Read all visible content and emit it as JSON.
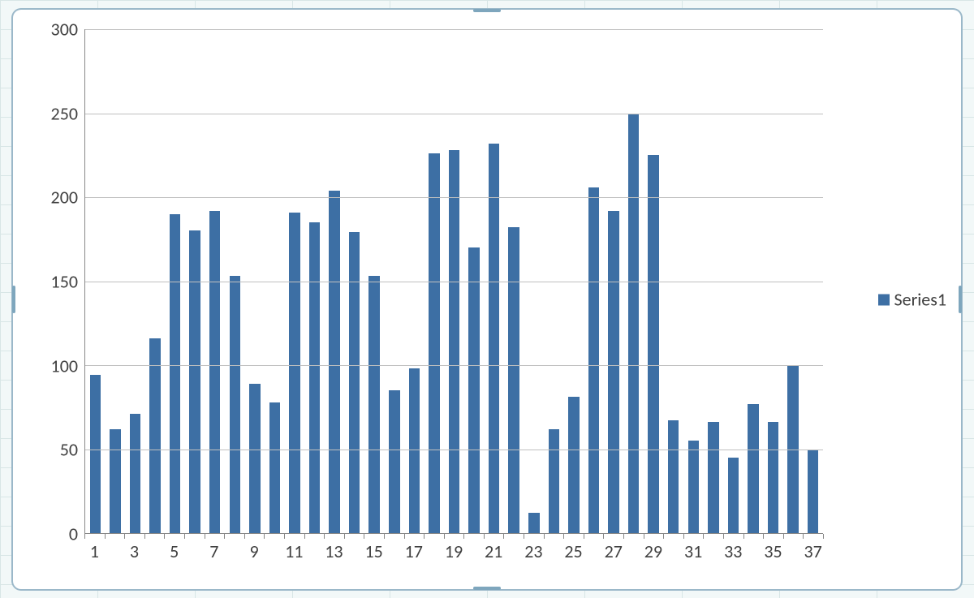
{
  "chart_data": {
    "type": "bar",
    "categories": [
      1,
      2,
      3,
      4,
      5,
      6,
      7,
      8,
      9,
      10,
      11,
      12,
      13,
      14,
      15,
      16,
      17,
      18,
      19,
      20,
      21,
      22,
      23,
      24,
      25,
      26,
      27,
      28,
      29,
      30,
      31,
      32,
      33,
      34,
      35,
      36,
      37
    ],
    "series": [
      {
        "name": "Series1",
        "values": [
          94,
          62,
          71,
          116,
          190,
          180,
          192,
          153,
          89,
          78,
          191,
          185,
          204,
          179,
          153,
          85,
          98,
          226,
          228,
          170,
          232,
          182,
          12,
          62,
          81,
          206,
          192,
          250,
          225,
          67,
          55,
          66,
          45,
          77,
          66,
          100,
          50
        ]
      }
    ],
    "ylabel": "",
    "xlabel": "",
    "title": "",
    "ylim": [
      0,
      300
    ],
    "y_ticks": [
      0,
      50,
      100,
      150,
      200,
      250,
      300
    ],
    "x_tick_labels": [
      1,
      3,
      5,
      7,
      9,
      11,
      13,
      15,
      17,
      19,
      21,
      23,
      25,
      27,
      29,
      31,
      33,
      35,
      37
    ]
  },
  "legend": {
    "items": [
      {
        "label": "Series1"
      }
    ]
  },
  "colors": {
    "bar": "#3d6fa4",
    "grid": "#bfbfbf",
    "axis": "#888888",
    "text": "#404040",
    "frame": "#9bb8c9"
  }
}
